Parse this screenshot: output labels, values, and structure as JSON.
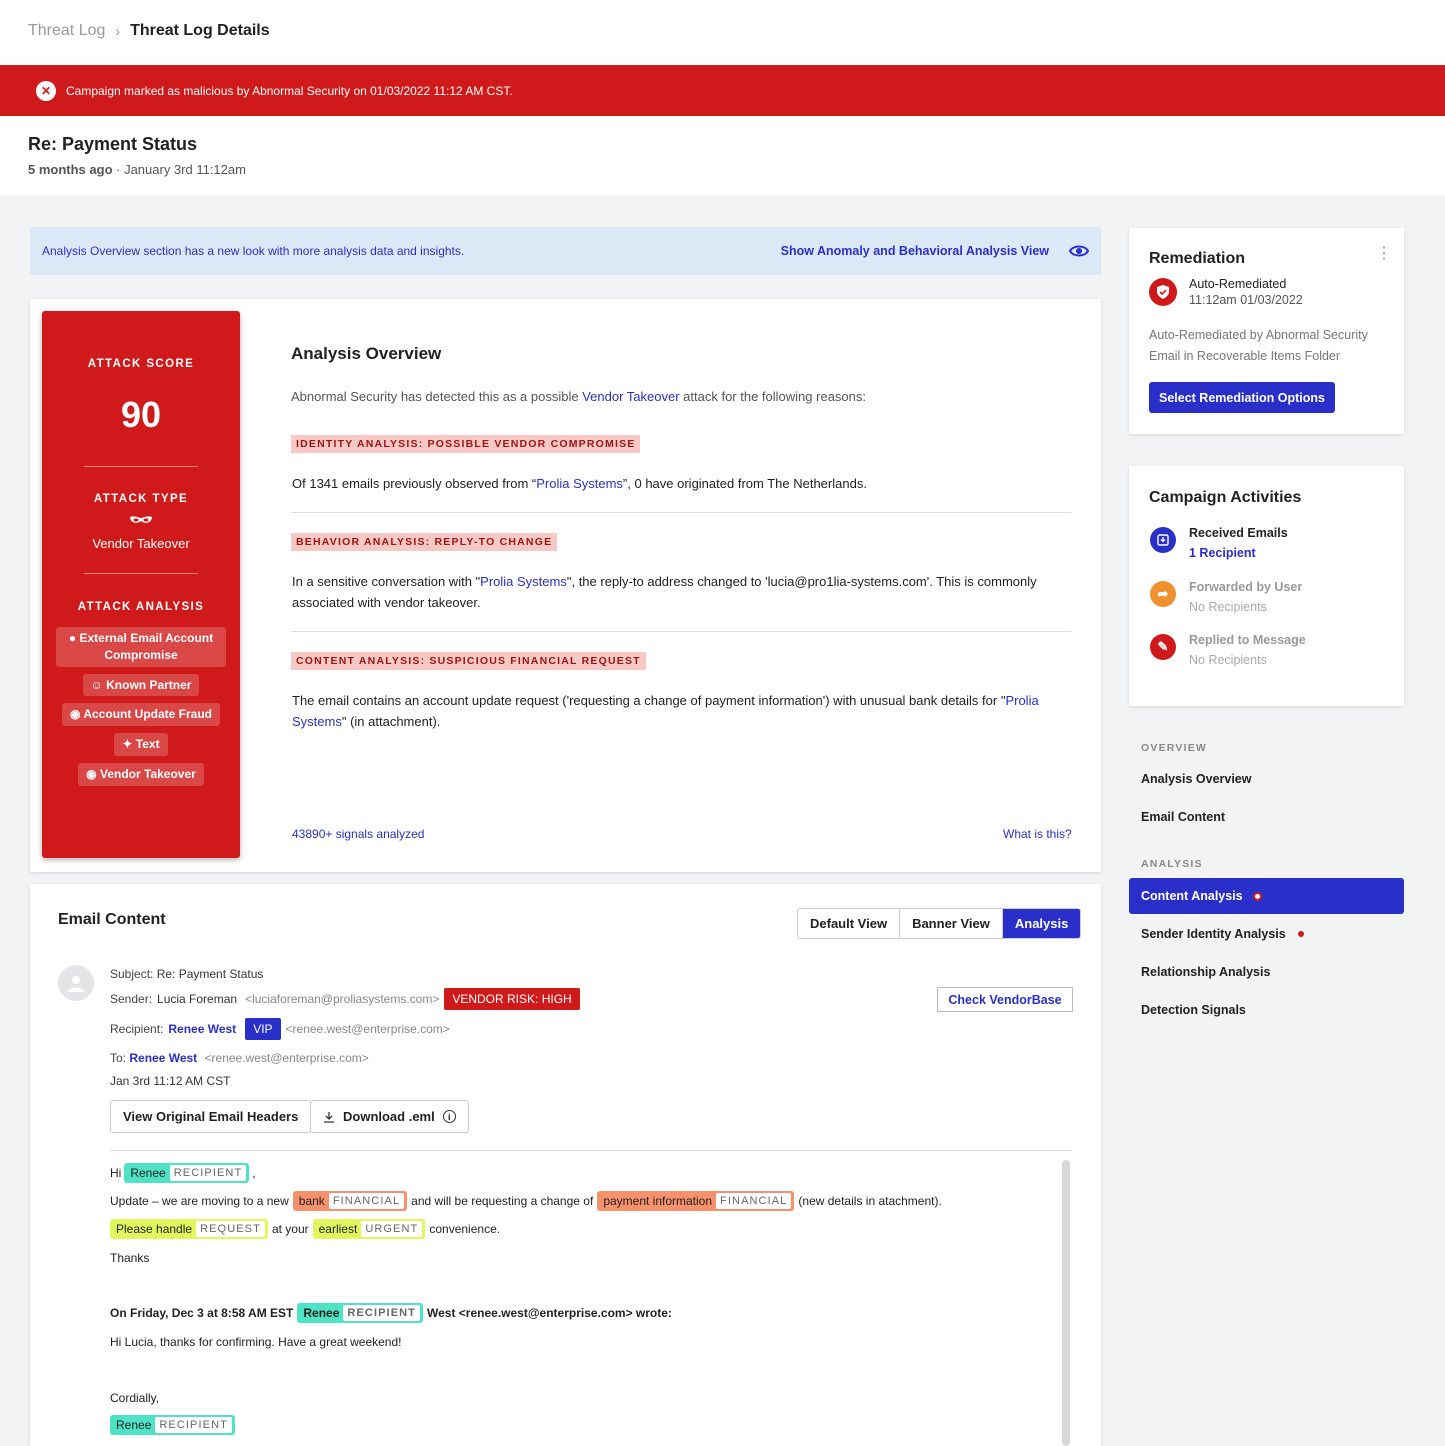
{
  "breadcrumb": {
    "parent": "Threat Log",
    "current": "Threat Log Details"
  },
  "alert": {
    "text": "Campaign marked as malicious by Abnormal Security on 01/03/2022 11:12 AM CST."
  },
  "header": {
    "title": "Re: Payment Status",
    "age": "5 months ago",
    "date": " · January 3rd 11:12am"
  },
  "info_banner": {
    "text": "Analysis Overview section has a new look with more analysis data and insights.",
    "link": "Show Anomaly and Behavioral Analysis View"
  },
  "score_card": {
    "score_label": "ATTACK SCORE",
    "score": "90",
    "type_label": "ATTACK TYPE",
    "type": "Vendor Takeover",
    "analysis_label": "ATTACK ANALYSIS",
    "tags": [
      "External Email Account Compromise",
      "Known Partner",
      "Account Update Fraud",
      "Text",
      "Vendor Takeover"
    ]
  },
  "overview": {
    "title": "Analysis Overview",
    "intro_pre": "Abnormal Security has detected this as a possible ",
    "intro_link": "Vendor Takeover",
    "intro_post": " attack for the following reasons:",
    "s1_pill": "IDENTITY ANALYSIS: POSSIBLE VENDOR COMPROMISE",
    "s1_pre": "Of 1341 emails previously observed from “",
    "s1_link": "Prolia Systems",
    "s1_post": "”, 0 have originated from The Netherlands.",
    "s2_pill": "BEHAVIOR ANALYSIS: REPLY-TO CHANGE",
    "s2_pre": "In a sensitive conversation with \"",
    "s2_link": "Prolia Systems",
    "s2_post": "\", the reply-to address changed to 'lucia@pro1lia-systems.com'. This is commonly associated with vendor takeover.",
    "s3_pill": "CONTENT ANALYSIS: SUSPICIOUS FINANCIAL REQUEST",
    "s3_pre": "The email contains an account update request ('requesting a change of payment information') with unusual bank details for \"",
    "s3_link": "Prolia Systems",
    "s3_post": "\" (in attachment).",
    "signals": "43890+ signals analyzed",
    "what": "What is this?"
  },
  "email": {
    "title": "Email Content",
    "tabs": [
      "Default View",
      "Banner View",
      "Analysis"
    ],
    "subject_k": "Subject:",
    "subject": "Re: Payment Status",
    "sender_k": "Sender:",
    "sender": "Lucia Foreman",
    "sender_addr": "<luciaforeman@proliasystems.com>",
    "vendor_risk": "VENDOR RISK: HIGH",
    "check_vendor": "Check VendorBase",
    "recipient_k": "Recipient:",
    "recipient": "Renee West",
    "vip": "VIP",
    "recipient_addr": "<renee.west@enterprise.com>",
    "to_k": "To:",
    "to": "Renee West",
    "to_addr": "<renee.west@enterprise.com>",
    "date": "Jan 3rd 11:12 AM CST",
    "btn_headers": "View Original Email Headers",
    "btn_download": "Download .eml",
    "hi": "Hi",
    "comma": ",",
    "renee": "Renee",
    "recipient_tag": "RECIPIENT",
    "update_pre": "Update – we are moving to a new",
    "bank": "bank",
    "financial": "FINANCIAL",
    "update_mid": "and will be requesting a change of",
    "payinfo": "payment information",
    "update_post": "(new details in atachment).",
    "please": "Please handle",
    "request": "REQUEST",
    "at_your": "at your",
    "earliest": "earliest",
    "urgent": "URGENT",
    "convenience": "convenience.",
    "thanks": "Thanks",
    "quote_pre": "On Friday, Dec 3 at 8:58 AM EST",
    "quote_post": "West <renee.west@enterprise.com> wrote:",
    "quote_body": "Hi Lucia, thanks for confirming. Have a great weekend!",
    "cordially": "Cordially,"
  },
  "remediation": {
    "title": "Remediation",
    "status": "Auto-Remediated",
    "time": "11:12am 01/03/2022",
    "desc1": "Auto-Remediated by Abnormal Security",
    "desc2": "Email in Recoverable Items Folder",
    "button": "Select Remediation Options"
  },
  "campaign": {
    "title": "Campaign Activities",
    "items": [
      {
        "label": "Received Emails",
        "sub": "1 Recipient",
        "color": "#2b2fc9"
      },
      {
        "label": "Forwarded by User",
        "sub": "No Recipients",
        "color": "#f0902e"
      },
      {
        "label": "Replied to Message",
        "sub": "No Recipients",
        "color": "#d0191a"
      }
    ]
  },
  "nav": {
    "overview_h": "OVERVIEW",
    "overview_items": [
      "Analysis Overview",
      "Email Content"
    ],
    "analysis_h": "ANALYSIS",
    "analysis_items": [
      "Content Analysis",
      "Sender Identity Analysis",
      "Relationship Analysis",
      "Detection Signals"
    ]
  }
}
